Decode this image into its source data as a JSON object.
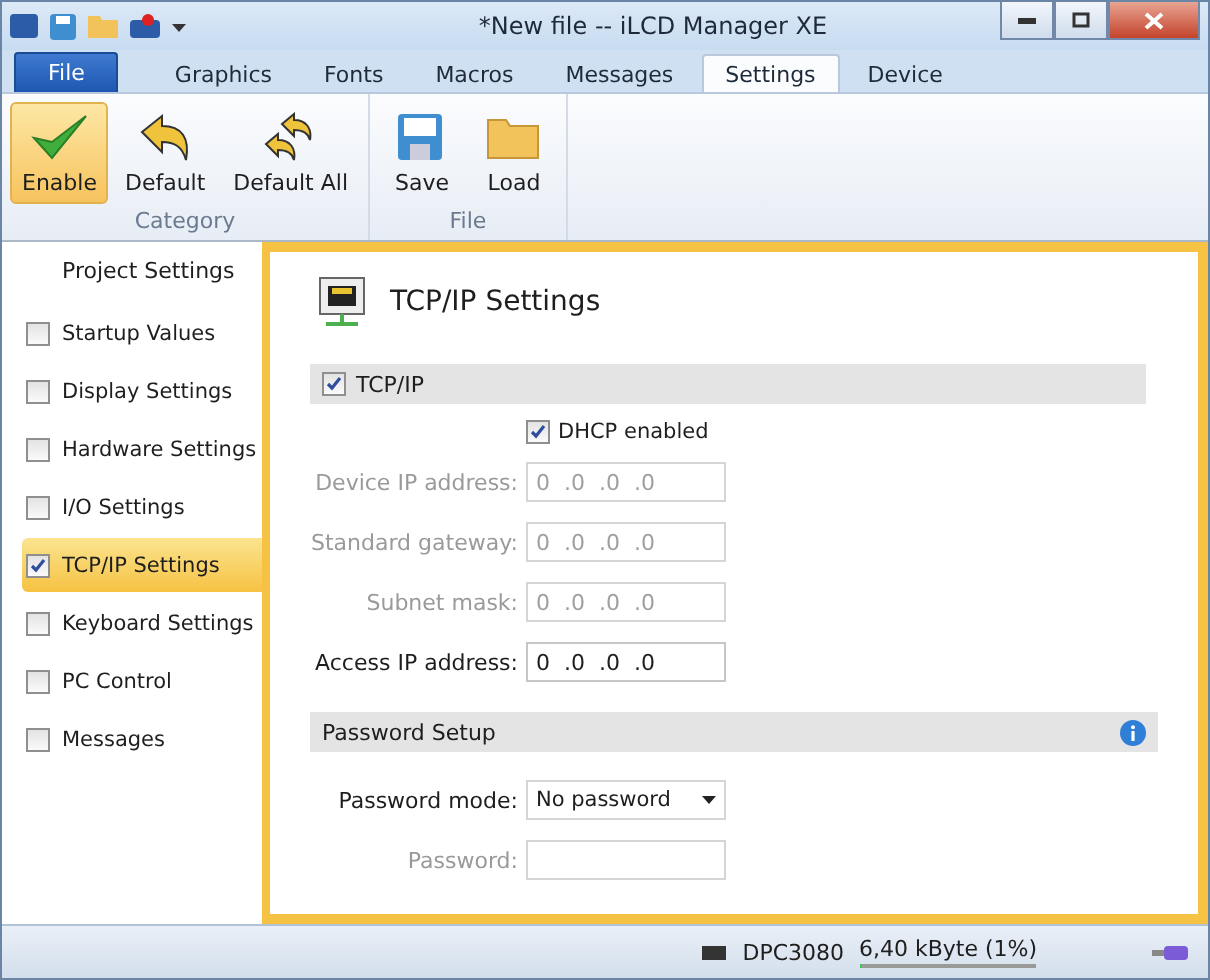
{
  "window": {
    "title": "*New file -- iLCD Manager XE"
  },
  "ribbon_tabs": [
    {
      "label": "File",
      "kind": "file",
      "selected": false
    },
    {
      "label": "Graphics",
      "kind": "tab",
      "selected": false
    },
    {
      "label": "Fonts",
      "kind": "tab",
      "selected": false
    },
    {
      "label": "Macros",
      "kind": "tab",
      "selected": false
    },
    {
      "label": "Messages",
      "kind": "tab",
      "selected": false
    },
    {
      "label": "Settings",
      "kind": "tab",
      "selected": true
    },
    {
      "label": "Device",
      "kind": "tab",
      "selected": false
    }
  ],
  "ribbon_groups": [
    {
      "label": "Category",
      "buttons": [
        {
          "label": "Enable",
          "kind": "check",
          "selected": true
        },
        {
          "label": "Default",
          "kind": "undo",
          "selected": false
        },
        {
          "label": "Default All",
          "kind": "undo-all",
          "selected": false
        }
      ]
    },
    {
      "label": "File",
      "buttons": [
        {
          "label": "Save",
          "kind": "save",
          "selected": false
        },
        {
          "label": "Load",
          "kind": "folder",
          "selected": false
        }
      ]
    }
  ],
  "sidebar": {
    "header": "Project Settings",
    "items": [
      {
        "label": "Startup Values",
        "checked": false,
        "selected": false
      },
      {
        "label": "Display Settings",
        "checked": false,
        "selected": false
      },
      {
        "label": "Hardware Settings",
        "checked": false,
        "selected": false
      },
      {
        "label": "I/O Settings",
        "checked": false,
        "selected": false
      },
      {
        "label": "TCP/IP Settings",
        "checked": true,
        "selected": true
      },
      {
        "label": "Keyboard Settings",
        "checked": false,
        "selected": false
      },
      {
        "label": "PC Control",
        "checked": false,
        "selected": false
      },
      {
        "label": "Messages",
        "checked": false,
        "selected": false
      }
    ]
  },
  "panel": {
    "title": "TCP/IP Settings",
    "tcpip_section": {
      "label": "TCP/IP",
      "checked": true
    },
    "dhcp": {
      "label": "DHCP enabled",
      "checked": true
    },
    "fields": [
      {
        "label": "Device IP address:",
        "value": "0  .0  .0  .0",
        "disabled": true
      },
      {
        "label": "Standard gateway:",
        "value": "0  .0  .0  .0",
        "disabled": true
      },
      {
        "label": "Subnet mask:",
        "value": "0  .0  .0  .0",
        "disabled": true
      },
      {
        "label": "Access IP address:",
        "value": "0  .0  .0  .0",
        "disabled": false
      }
    ],
    "password_section": {
      "label": "Password Setup"
    },
    "password_mode": {
      "label": "Password mode:",
      "value": "No password"
    },
    "password": {
      "label": "Password:",
      "disabled": true
    }
  },
  "status_bar": {
    "device": "DPC3080",
    "memory": "6,40 kByte (1%)",
    "level": 0.01
  }
}
